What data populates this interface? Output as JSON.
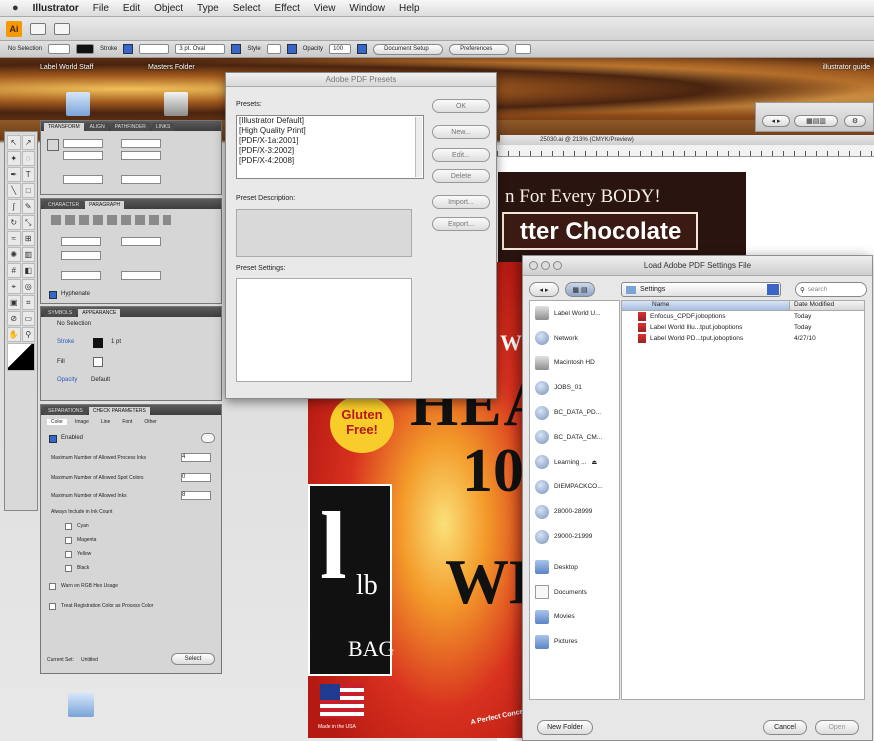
{
  "menubar": {
    "app": "Illustrator",
    "items": [
      "File",
      "Edit",
      "Object",
      "Type",
      "Select",
      "Effect",
      "View",
      "Window",
      "Help"
    ]
  },
  "controlbar": {
    "selection": "No Selection",
    "stroke_label": "Stroke",
    "brush_value": "3 pt. Oval",
    "style_label": "Style",
    "opacity_label": "Opacity",
    "opacity_value": "100",
    "doc_setup": "Document Setup",
    "preferences": "Preferences"
  },
  "desktop": {
    "label_world_staff": "Label World Staff",
    "masters_folder": "Masters Folder",
    "illustrator_guide": "illustrator guide"
  },
  "panels": {
    "transform_tabs": [
      "TRANSFORM",
      "ALIGN",
      "PATHFINDER",
      "LINKS"
    ],
    "character_tabs": [
      "CHARACTER",
      "PARAGRAPH"
    ],
    "appearance_tabs": [
      "SYMBOLS",
      "APPEARANCE"
    ],
    "appearance_rows": [
      "No Selection",
      "Stroke",
      "Fill",
      "Opacity"
    ],
    "stroke_value": "1 pt",
    "opacity_default": "Default",
    "hyphenate": "Hyphenate",
    "preflight_tabs": [
      "SEPARATIONS",
      "CHECK PARAMETERS"
    ],
    "preflight_subtabs": [
      "Color",
      "Image",
      "Line",
      "Font",
      "Other"
    ],
    "enabled": "Enabled",
    "max_process_inks": "Maximum Number of Allowed Process Inks",
    "max_spot_colors": "Maximum Number of Allowed Spot Colors",
    "max_inks": "Maximum Number of Allowed Inks",
    "inks_value": "4",
    "spot_value": "0",
    "total_value": "8",
    "must_include": "Always Include in Ink Count",
    "inks": [
      "Cyan",
      "Magenta",
      "Yellow",
      "Black"
    ],
    "warn_rgb": "Warn on RGB Hex Usage",
    "warn_registration": "Treat Registration Color as Process Color",
    "current_set": "Current Set:",
    "current_set_value": "Untitled",
    "select_btn": "Select"
  },
  "pdf_presets": {
    "title": "Adobe PDF Presets",
    "presets_label": "Presets:",
    "presets": [
      "[Illustrator Default]",
      "[High Quality Print]",
      "[PDF/X-1a:2001]",
      "[PDF/X-3:2002]",
      "[PDF/X-4:2008]"
    ],
    "description_label": "Preset Description:",
    "settings_label": "Preset Settings:",
    "buttons": [
      "OK",
      "New...",
      "Edit...",
      "Delete",
      "Import...",
      "Export..."
    ]
  },
  "document": {
    "title": "25030.ai @ 213% (CMYK/Preview)",
    "art_tagline": "n For Every BODY!",
    "art_banner": "tter Chocolate",
    "art_gluten": "Gluten Free!",
    "art_big_letter": "l",
    "art_lb": "lb",
    "art_bag": "BAG",
    "art_hea": "HEA",
    "art_num": "10",
    "art_wh": "WH",
    "art_w": "W",
    "art_made": "Made in the USA",
    "art_perfect": "A Perfect Concentrati"
  },
  "load_dialog": {
    "title": "Load Adobe PDF Settings File",
    "location": "Settings",
    "search_placeholder": "search",
    "sidebar": [
      {
        "label": "Label World U...",
        "icon": "drive-icon",
        "type": "drive"
      },
      {
        "label": "Network",
        "icon": "network-icon",
        "type": "net"
      },
      {
        "label": "Macintosh HD",
        "icon": "hard-drive-icon",
        "type": "drive"
      },
      {
        "label": "JOBS_01",
        "icon": "server-icon",
        "type": "net"
      },
      {
        "label": "BC_DATA_PD...",
        "icon": "server-icon",
        "type": "net"
      },
      {
        "label": "BC_DATA_CM...",
        "icon": "server-icon",
        "type": "net"
      },
      {
        "label": "Learning ...",
        "icon": "server-icon",
        "type": "net"
      },
      {
        "label": "DIEMPACKCO...",
        "icon": "server-icon",
        "type": "net"
      },
      {
        "label": "28000-28999",
        "icon": "server-icon",
        "type": "net"
      },
      {
        "label": "29000-21999",
        "icon": "server-icon",
        "type": "net"
      }
    ],
    "places": [
      {
        "label": "Desktop",
        "icon": "desktop-icon",
        "type": "folder"
      },
      {
        "label": "Documents",
        "icon": "documents-icon",
        "type": "doc"
      },
      {
        "label": "Movies",
        "icon": "movies-icon",
        "type": "folder"
      },
      {
        "label": "Pictures",
        "icon": "pictures-icon",
        "type": "folder"
      }
    ],
    "col_name": "Name",
    "col_date": "Date Modified",
    "files": [
      {
        "name": "Enfocus_CPDF.joboptions",
        "date": "Today"
      },
      {
        "name": "Label World Illu...tput.joboptions",
        "date": "Today"
      },
      {
        "name": "Label World PD...tput.joboptions",
        "date": "4/27/10"
      }
    ],
    "new_folder": "New Folder",
    "cancel": "Cancel",
    "open": "Open"
  }
}
